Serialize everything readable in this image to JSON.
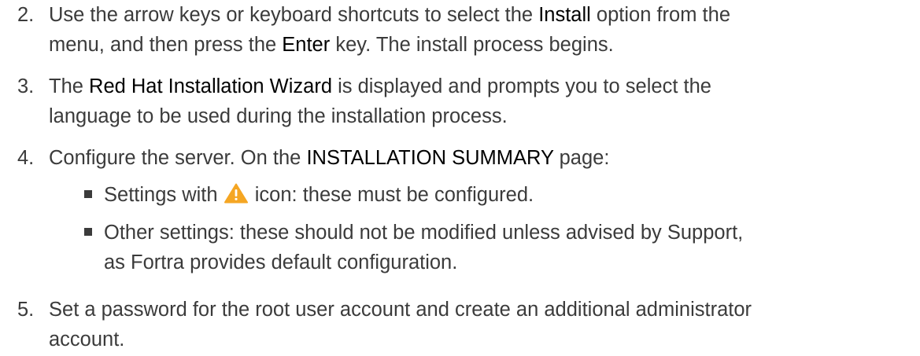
{
  "steps": [
    {
      "number": "2.",
      "line1_before": "Use the arrow keys or keyboard shortcuts to select the ",
      "line1_ui": "Install",
      "line1_after": " option from the",
      "line2_before": "menu, and then press the ",
      "line2_ui": "Enter",
      "line2_after": " key. The install process begins."
    },
    {
      "number": "3.",
      "line1_before": "The ",
      "line1_ui": "Red Hat Installation Wizard",
      "line1_after": " is displayed and prompts you to select the",
      "line2": "language to be used during the installation process."
    },
    {
      "number": "4.",
      "line1_before": "Configure the server. On the ",
      "line1_ui": "INSTALLATION SUMMARY",
      "line1_after": " page:",
      "subitems": [
        {
          "before_icon": "Settings with ",
          "icon": "warning-triangle-icon",
          "after_icon": " icon: these must be configured."
        },
        {
          "line1": "Other settings: these should not be modified unless advised by Support,",
          "line2": "as Fortra provides default configuration."
        }
      ]
    },
    {
      "number": "5.",
      "line1": "Set a password for the root user account and create an additional administrator",
      "line2": "account."
    }
  ],
  "colors": {
    "body_text": "#3b3b3b",
    "ui_text": "#000000",
    "warning_fill": "#f5a623"
  }
}
